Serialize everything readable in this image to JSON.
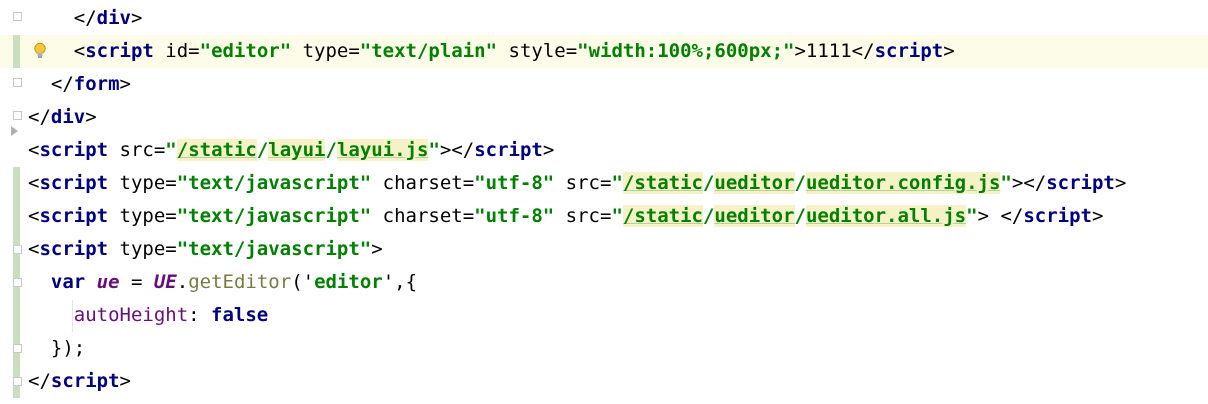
{
  "editor": {
    "language": "HTML",
    "current_line_index": 1,
    "colors": {
      "tag": "#000080",
      "string": "#008000",
      "keyword": "#000080",
      "variable": "#660e7a",
      "method": "#7a7a43",
      "current_line_bg": "#fdfce8",
      "path_highlight_bg": "#f5f2c8",
      "change_marker": "#c9dfc0"
    },
    "lines": [
      {
        "parts": [
          "    ",
          "</",
          "div",
          ">"
        ]
      },
      {
        "parts": [
          "    ",
          "<",
          "script",
          " id=",
          "\"editor\"",
          " type=",
          "\"text/plain\"",
          " style=",
          "\"width:100%;600px;\"",
          ">1111</",
          "script",
          ">"
        ]
      },
      {
        "parts": [
          "  ",
          "</",
          "form",
          ">"
        ]
      },
      {
        "parts": [
          "",
          "</",
          "div",
          ">"
        ]
      },
      {
        "parts": [
          "<",
          "script",
          " src=",
          "\"",
          "/static",
          "/",
          "layui",
          "/",
          "layui.js",
          "\"",
          "></",
          "script",
          ">"
        ]
      },
      {
        "parts": [
          "<",
          "script",
          " type=",
          "\"text/javascript\"",
          " charset=",
          "\"utf-8\"",
          " src=",
          "\"",
          "/static",
          "/",
          "ueditor",
          "/",
          "ueditor.config.js",
          "\"",
          "></",
          "script",
          ">"
        ]
      },
      {
        "parts": [
          "<",
          "script",
          " type=",
          "\"text/javascript\"",
          " charset=",
          "\"utf-8\"",
          " src=",
          "\"",
          "/static",
          "/",
          "ueditor",
          "/",
          "ueditor.all.js",
          "\"",
          "> </",
          "script",
          ">"
        ]
      },
      {
        "parts": [
          "<",
          "script",
          " type=",
          "\"text/javascript\"",
          ">"
        ]
      },
      {
        "parts": [
          "  ",
          "var",
          " ",
          "ue",
          " = ",
          "UE",
          ".",
          "getEditor",
          "('",
          "editor",
          "',{"
        ]
      },
      {
        "parts": [
          "    ",
          "autoHeight",
          ": ",
          "false"
        ]
      },
      {
        "parts": [
          "  ",
          "});"
        ]
      },
      {
        "parts": [
          "</",
          "script",
          ">"
        ]
      }
    ]
  }
}
